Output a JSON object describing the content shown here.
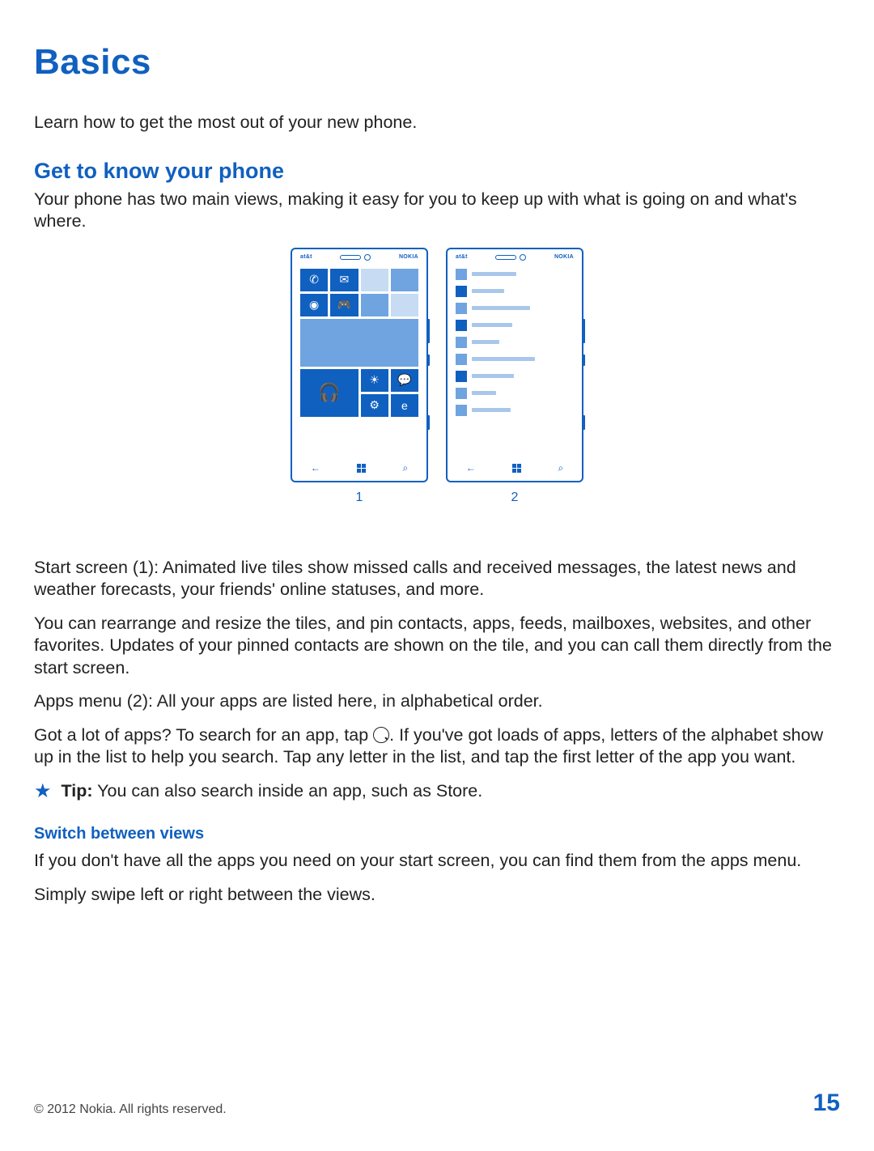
{
  "title": "Basics",
  "intro": "Learn how to get the most out of your new phone.",
  "subtitle": "Get to know your phone",
  "subtitle_text": "Your phone has two main views, making it easy for you to keep up with what is going on and what's where.",
  "illustration": {
    "carrier": "at&t",
    "brand": "NOKIA",
    "label_1": "1",
    "label_2": "2"
  },
  "para1": "Start screen (1): Animated live tiles show missed calls and received messages, the latest news and weather forecasts, your friends' online statuses, and more.",
  "para2": "You can rearrange and resize the tiles, and pin contacts, apps, feeds, mailboxes, websites, and other favorites. Updates of your pinned contacts are shown on the tile, and you can call them directly from the start screen.",
  "para3": "Apps menu (2): All your apps are listed here, in alphabetical order.",
  "para4_a": "Got a lot of apps? To search for an app, tap ",
  "para4_b": ". If you've got loads of apps, letters of the alphabet show up in the list to help you search. Tap any letter in the list, and tap the first letter of the app you want.",
  "tip_label": "Tip:",
  "tip_text": " You can also search inside an app, such as Store.",
  "section_switch": "Switch between views",
  "switch_p1": "If you don't have all the apps you need on your start screen, you can find them from the apps menu.",
  "switch_p2": "Simply swipe left or right between the views.",
  "footer": {
    "copyright": "© 2012 Nokia. All rights reserved.",
    "page": "15"
  }
}
